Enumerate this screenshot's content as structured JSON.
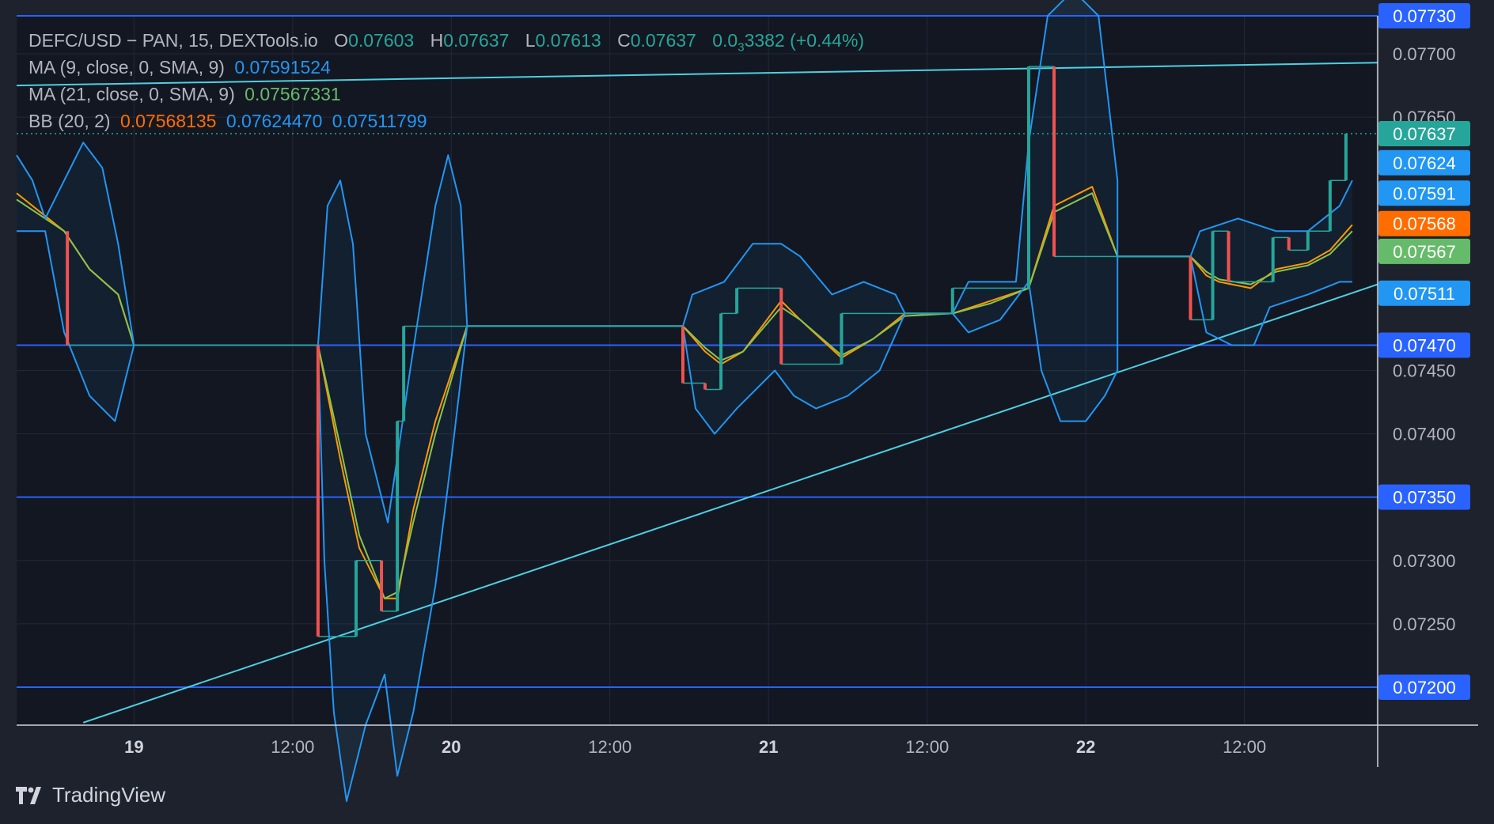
{
  "legend": {
    "symbol": "DEFC/USD − PAN, 15, DEXTools.io",
    "o_label": "O",
    "o_value": "0.07603",
    "h_label": "H",
    "h_value": "0.07637",
    "l_label": "L",
    "l_value": "0.07613",
    "c_label": "C",
    "c_value": "0.07637",
    "change_main": "0.0",
    "change_sub": "3",
    "change_rest": "3382 (+0.44%)",
    "ma9_label": "MA (9, close, 0, SMA, 9)",
    "ma9_value": "0.07591524",
    "ma21_label": "MA (21, close, 0, SMA, 9)",
    "ma21_value": "0.07567331",
    "bb_label": "BB (20, 2)",
    "bb_basis": "0.07568135",
    "bb_upper": "0.07624470",
    "bb_lower": "0.07511799"
  },
  "brand": "TradingView",
  "colors": {
    "background": "#1e222d",
    "pane": "#131722",
    "up": "#26a69a",
    "down": "#ef5350",
    "bb": "#2196f3",
    "ma9": "#ff9800",
    "ma21": "#8bc34a",
    "trendline": "#4dd0e1",
    "hline": "#2962ff"
  },
  "chart_data": {
    "type": "candlestick",
    "ylim": [
      0.0717,
      0.0773
    ],
    "x_ticks": [
      {
        "label": "19",
        "x": 0
      },
      {
        "label": "12:00",
        "x": 0.5
      },
      {
        "label": "20",
        "x": 1
      },
      {
        "label": "12:00",
        "x": 1.5
      },
      {
        "label": "21",
        "x": 2
      },
      {
        "label": "12:00",
        "x": 2.5
      },
      {
        "label": "22",
        "x": 3
      },
      {
        "label": "12:00",
        "x": 3.5
      }
    ],
    "xlim": [
      -0.37,
      3.92
    ],
    "y_ticks": [
      "0.07700",
      "0.07650",
      "0.07450",
      "0.07400",
      "0.07300",
      "0.07250"
    ],
    "y_tick_values": [
      0.077,
      0.0765,
      0.0745,
      0.074,
      0.073,
      0.0725
    ],
    "horizontal_lines": [
      {
        "label": "0.07730",
        "value": 0.0773
      },
      {
        "label": "0.07470",
        "value": 0.0747
      },
      {
        "label": "0.07350",
        "value": 0.0735
      },
      {
        "label": "0.07200",
        "value": 0.072
      }
    ],
    "trendlines": [
      {
        "x1": -0.37,
        "y1": 0.07675,
        "x2": 3.92,
        "y2": 0.07693
      },
      {
        "x1": -0.16,
        "y1": 0.07172,
        "x2": 3.92,
        "y2": 0.07518
      }
    ],
    "last_price_line": 0.07637,
    "price_labels": [
      {
        "label": "0.07637",
        "value": 0.07637,
        "color": "#26a69a"
      },
      {
        "label": "0.07624",
        "value": 0.07614,
        "color": "#2196f3"
      },
      {
        "label": "0.07591",
        "value": 0.0759,
        "color": "#2196f3"
      },
      {
        "label": "0.07568",
        "value": 0.07566,
        "color": "#ff6d00"
      },
      {
        "label": "0.07567",
        "value": 0.07544,
        "color": "#66bb6a"
      },
      {
        "label": "0.07511",
        "value": 0.07511,
        "color": "#2196f3"
      },
      {
        "label": "0.07470",
        "value": 0.0747,
        "color": "#2962ff"
      }
    ],
    "candles": [
      {
        "x": -0.21,
        "o": 0.0756,
        "c": 0.0747,
        "dir": "down"
      },
      {
        "x": 0.58,
        "o": 0.0747,
        "c": 0.0724,
        "dir": "down"
      },
      {
        "x": 0.7,
        "o": 0.0724,
        "c": 0.073,
        "dir": "up"
      },
      {
        "x": 0.78,
        "o": 0.073,
        "c": 0.0726,
        "dir": "down"
      },
      {
        "x": 0.83,
        "o": 0.0726,
        "c": 0.0741,
        "dir": "up"
      },
      {
        "x": 0.85,
        "o": 0.0741,
        "c": 0.07485,
        "dir": "up"
      },
      {
        "x": 1.73,
        "o": 0.07485,
        "c": 0.0744,
        "dir": "down"
      },
      {
        "x": 1.8,
        "o": 0.0744,
        "c": 0.07435,
        "dir": "down"
      },
      {
        "x": 1.85,
        "o": 0.07435,
        "c": 0.07495,
        "dir": "up"
      },
      {
        "x": 1.9,
        "o": 0.07495,
        "c": 0.07515,
        "dir": "up"
      },
      {
        "x": 2.04,
        "o": 0.07515,
        "c": 0.07455,
        "dir": "down"
      },
      {
        "x": 2.23,
        "o": 0.07455,
        "c": 0.07495,
        "dir": "up"
      },
      {
        "x": 2.58,
        "o": 0.07495,
        "c": 0.07515,
        "dir": "up"
      },
      {
        "x": 2.82,
        "o": 0.07515,
        "c": 0.0769,
        "dir": "up"
      },
      {
        "x": 2.9,
        "o": 0.0769,
        "c": 0.0754,
        "dir": "down"
      },
      {
        "x": 3.33,
        "o": 0.0754,
        "c": 0.0749,
        "dir": "down"
      },
      {
        "x": 3.4,
        "o": 0.0749,
        "c": 0.0756,
        "dir": "up"
      },
      {
        "x": 3.45,
        "o": 0.0756,
        "c": 0.0752,
        "dir": "down"
      },
      {
        "x": 3.59,
        "o": 0.0752,
        "c": 0.07555,
        "dir": "up"
      },
      {
        "x": 3.64,
        "o": 0.07555,
        "c": 0.07545,
        "dir": "down"
      },
      {
        "x": 3.7,
        "o": 0.07545,
        "c": 0.0756,
        "dir": "up"
      },
      {
        "x": 3.77,
        "o": 0.0756,
        "c": 0.076,
        "dir": "up"
      },
      {
        "x": 3.82,
        "o": 0.076,
        "c": 0.07637,
        "dir": "up"
      }
    ],
    "series": [
      {
        "name": "MA (9, close, 0, SMA, 9)",
        "color": "#ff9800",
        "points": [
          [
            -0.37,
            0.0759
          ],
          [
            -0.22,
            0.0756
          ],
          [
            -0.14,
            0.0753
          ],
          [
            -0.05,
            0.0751
          ],
          [
            0.0,
            0.0747
          ],
          [
            0.58,
            0.0747
          ],
          [
            0.65,
            0.0738
          ],
          [
            0.71,
            0.0731
          ],
          [
            0.79,
            0.0727
          ],
          [
            0.83,
            0.0727
          ],
          [
            0.88,
            0.0734
          ],
          [
            0.95,
            0.0741
          ],
          [
            1.05,
            0.07485
          ],
          [
            1.73,
            0.07485
          ],
          [
            1.8,
            0.07465
          ],
          [
            1.85,
            0.07455
          ],
          [
            1.92,
            0.07465
          ],
          [
            2.04,
            0.07505
          ],
          [
            2.1,
            0.0749
          ],
          [
            2.23,
            0.0746
          ],
          [
            2.33,
            0.07475
          ],
          [
            2.43,
            0.07495
          ],
          [
            2.58,
            0.07495
          ],
          [
            2.7,
            0.07505
          ],
          [
            2.82,
            0.07515
          ],
          [
            2.9,
            0.0758
          ],
          [
            3.02,
            0.07595
          ],
          [
            3.1,
            0.0754
          ],
          [
            3.33,
            0.0754
          ],
          [
            3.38,
            0.07525
          ],
          [
            3.42,
            0.0752
          ],
          [
            3.52,
            0.07515
          ],
          [
            3.6,
            0.0753
          ],
          [
            3.7,
            0.07535
          ],
          [
            3.77,
            0.07545
          ],
          [
            3.84,
            0.07565
          ]
        ]
      },
      {
        "name": "MA (21, close, 0, SMA, 9)",
        "color": "#8bc34a",
        "points": [
          [
            -0.37,
            0.07585
          ],
          [
            -0.22,
            0.0756
          ],
          [
            -0.14,
            0.0753
          ],
          [
            -0.05,
            0.0751
          ],
          [
            0.0,
            0.0747
          ],
          [
            0.58,
            0.0747
          ],
          [
            0.65,
            0.0739
          ],
          [
            0.71,
            0.0732
          ],
          [
            0.79,
            0.0727
          ],
          [
            0.83,
            0.07275
          ],
          [
            0.88,
            0.0733
          ],
          [
            0.95,
            0.074
          ],
          [
            1.05,
            0.07485
          ],
          [
            1.73,
            0.07485
          ],
          [
            1.8,
            0.07468
          ],
          [
            1.85,
            0.07458
          ],
          [
            1.92,
            0.07465
          ],
          [
            2.04,
            0.075
          ],
          [
            2.1,
            0.0749
          ],
          [
            2.23,
            0.07462
          ],
          [
            2.33,
            0.07475
          ],
          [
            2.43,
            0.07493
          ],
          [
            2.58,
            0.07495
          ],
          [
            2.7,
            0.07503
          ],
          [
            2.82,
            0.07515
          ],
          [
            2.9,
            0.07575
          ],
          [
            3.02,
            0.0759
          ],
          [
            3.1,
            0.0754
          ],
          [
            3.33,
            0.0754
          ],
          [
            3.38,
            0.07528
          ],
          [
            3.42,
            0.07522
          ],
          [
            3.52,
            0.07518
          ],
          [
            3.6,
            0.07528
          ],
          [
            3.7,
            0.07533
          ],
          [
            3.77,
            0.07542
          ],
          [
            3.84,
            0.0756
          ]
        ]
      },
      {
        "name": "BB upper",
        "color": "#2196f3",
        "points": [
          [
            -0.37,
            0.0762
          ],
          [
            -0.32,
            0.076
          ],
          [
            -0.28,
            0.0757
          ],
          [
            -0.22,
            0.076
          ],
          [
            -0.16,
            0.0763
          ],
          [
            -0.1,
            0.0761
          ],
          [
            -0.05,
            0.0755
          ],
          [
            0.0,
            0.0747
          ],
          [
            0.58,
            0.0747
          ],
          [
            0.61,
            0.0758
          ],
          [
            0.65,
            0.076
          ],
          [
            0.69,
            0.0755
          ],
          [
            0.73,
            0.074
          ],
          [
            0.8,
            0.0733
          ],
          [
            0.87,
            0.0745
          ],
          [
            0.95,
            0.0758
          ],
          [
            0.99,
            0.0762
          ],
          [
            1.03,
            0.0758
          ],
          [
            1.05,
            0.07485
          ],
          [
            1.73,
            0.07485
          ],
          [
            1.76,
            0.0751
          ],
          [
            1.86,
            0.0752
          ],
          [
            1.95,
            0.0755
          ],
          [
            2.04,
            0.0755
          ],
          [
            2.1,
            0.0754
          ],
          [
            2.2,
            0.0751
          ],
          [
            2.3,
            0.0752
          ],
          [
            2.4,
            0.0751
          ],
          [
            2.43,
            0.07495
          ],
          [
            2.58,
            0.07495
          ],
          [
            2.63,
            0.0752
          ],
          [
            2.78,
            0.0752
          ],
          [
            2.82,
            0.0763
          ],
          [
            2.88,
            0.0773
          ],
          [
            2.96,
            0.0775
          ],
          [
            3.04,
            0.0773
          ],
          [
            3.1,
            0.076
          ],
          [
            3.1,
            0.0754
          ],
          [
            3.33,
            0.0754
          ],
          [
            3.36,
            0.0756
          ],
          [
            3.48,
            0.0757
          ],
          [
            3.6,
            0.0756
          ],
          [
            3.7,
            0.0756
          ],
          [
            3.8,
            0.0758
          ],
          [
            3.84,
            0.076
          ]
        ]
      },
      {
        "name": "BB lower",
        "color": "#2196f3",
        "points": [
          [
            -0.37,
            0.0756
          ],
          [
            -0.28,
            0.0756
          ],
          [
            -0.22,
            0.0748
          ],
          [
            -0.14,
            0.0743
          ],
          [
            -0.06,
            0.0741
          ],
          [
            -0.02,
            0.0745
          ],
          [
            0.0,
            0.0747
          ],
          [
            0.58,
            0.0747
          ],
          [
            0.6,
            0.073
          ],
          [
            0.63,
            0.0718
          ],
          [
            0.67,
            0.0711
          ],
          [
            0.73,
            0.0717
          ],
          [
            0.79,
            0.0721
          ],
          [
            0.83,
            0.0713
          ],
          [
            0.88,
            0.0718
          ],
          [
            0.95,
            0.0728
          ],
          [
            1.0,
            0.0738
          ],
          [
            1.05,
            0.07485
          ],
          [
            1.73,
            0.07485
          ],
          [
            1.77,
            0.0742
          ],
          [
            1.83,
            0.074
          ],
          [
            1.9,
            0.0742
          ],
          [
            2.02,
            0.0745
          ],
          [
            2.08,
            0.0743
          ],
          [
            2.15,
            0.0742
          ],
          [
            2.25,
            0.0743
          ],
          [
            2.35,
            0.0745
          ],
          [
            2.43,
            0.07495
          ],
          [
            2.58,
            0.07495
          ],
          [
            2.63,
            0.0748
          ],
          [
            2.73,
            0.0749
          ],
          [
            2.82,
            0.0752
          ],
          [
            2.86,
            0.0745
          ],
          [
            2.92,
            0.0741
          ],
          [
            3.0,
            0.0741
          ],
          [
            3.06,
            0.0743
          ],
          [
            3.1,
            0.0745
          ],
          [
            3.1,
            0.0754
          ],
          [
            3.33,
            0.0754
          ],
          [
            3.38,
            0.0748
          ],
          [
            3.46,
            0.0747
          ],
          [
            3.53,
            0.0747
          ],
          [
            3.58,
            0.075
          ],
          [
            3.7,
            0.0751
          ],
          [
            3.8,
            0.0752
          ],
          [
            3.84,
            0.0752
          ]
        ]
      }
    ]
  }
}
